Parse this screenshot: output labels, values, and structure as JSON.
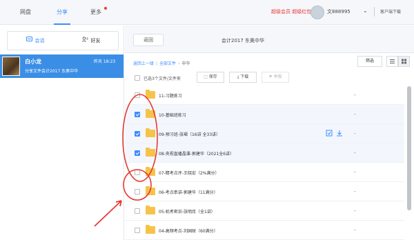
{
  "topnav": {
    "tabs": [
      {
        "label": "网盘"
      },
      {
        "label": "分享"
      },
      {
        "label": "更多"
      }
    ],
    "links": "超级会员  超级红包",
    "username": "文888995",
    "client": "客户端下载"
  },
  "left": {
    "tabs": [
      {
        "label": "会话",
        "icon": "chat-icon"
      },
      {
        "label": "好友",
        "icon": "friend-icon"
      }
    ],
    "session": {
      "title": "白小龙",
      "time": "昨天 18:23",
      "message": "分享文件会计2017 东奥中华"
    }
  },
  "right": {
    "back_label": "返回",
    "title": "会计2017 东奥中华",
    "breadcrumb": {
      "up": "返回上一级",
      "all": "全部文件",
      "current": "中华"
    },
    "filter_label": "筛选",
    "toolbar": {
      "count_text": "已选3个文件/文件夹",
      "save_label": "保存",
      "download_label": "下载",
      "report_label": "举报"
    },
    "files": [
      {
        "name": "11-习题练习",
        "size": "-",
        "checked": false
      },
      {
        "name": "10-基础班练习",
        "size": "-",
        "checked": true
      },
      {
        "name": "09-预习班-张珺（16讲 全33讲）",
        "size": "-",
        "checked": true
      },
      {
        "name": "08-央视直播晶课-郭建华（2021全6讲）",
        "size": "-",
        "checked": true
      },
      {
        "name": "07-精考点评-王晓宏（2%满分）",
        "size": "-",
        "checked": false
      },
      {
        "name": "06-考点串讲-郭建华（11满分）",
        "size": "-",
        "checked": false
      },
      {
        "name": "05-机考密训-张明月（全1讲）",
        "size": "-",
        "checked": false
      },
      {
        "name": "04-高频考点-刘国财（60满分）",
        "size": "-",
        "checked": false
      }
    ]
  },
  "colors": {
    "accent": "#3b8cff",
    "session_bg": "#3a8ee6",
    "folder": "#f6c34a",
    "annotation": "#e53935"
  }
}
